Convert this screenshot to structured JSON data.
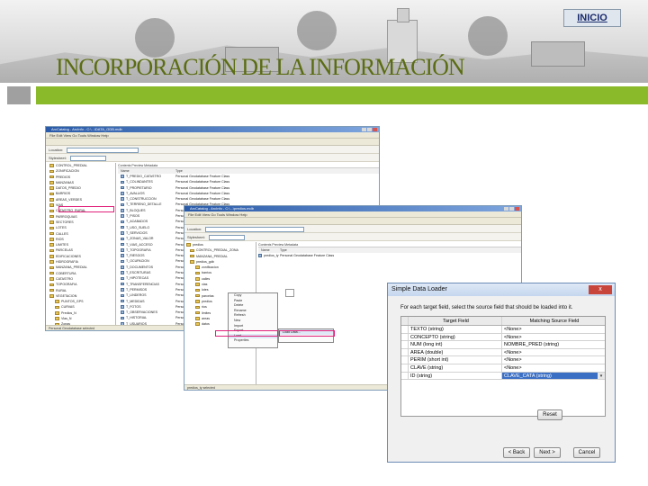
{
  "header": {
    "inicio_label": "INICIO",
    "title": "INCORPORACIÓN DE LA INFORMACIÓN"
  },
  "colors": {
    "title": "#5b6d13",
    "green_bar": "#8ab929",
    "highlight": "#e0207a",
    "selection": "#3b6fc4"
  },
  "window1": {
    "title": "ArcCatalog - ArcInfo - C:\\...\\DATA_GDB.mdb",
    "menu": "File  Edit  View  Go  Tools  Window  Help",
    "location_label": "Location:",
    "stylesheet_label": "Stylesheet:",
    "tabs": "Contents  Preview  Metadata",
    "col_name": "Name",
    "col_type": "Type",
    "tree": [
      "CONTROL_PREDIAL",
      "ZONIFICACION",
      "PREDIOS",
      "MANZANAS",
      "DATOS_PREDIO",
      "BARRIOS",
      "AREAS_VERDES",
      "VIAS",
      "CATASTRO_RURAL",
      "PARROQUIAS",
      "SECTORES",
      "LOTES",
      "CALLES",
      "RIOS",
      "LIMITES",
      "PARCELAS",
      "EDIFICACIONES",
      "HIDROGRAFIA",
      "MANZANA_PREDIAL",
      "COBERTURA",
      "CATASTRO",
      "TOPOGRAFIA",
      "RURAL",
      "VEGETACION",
      "PUNTOS_GPS",
      "CURVAS",
      "Predios_N",
      "Vias_N",
      "Zonas",
      "predios_gdb"
    ],
    "rows": [
      "T_PREDIO_CATASTRO",
      "T_COLINDANTES",
      "T_PROPIETARIO",
      "T_AVALUOS",
      "T_CONSTRUCCION",
      "T_TERRENO_DETALLE",
      "T_BLOQUES",
      "T_PISOS",
      "T_ACABADOS",
      "T_USO_SUELO",
      "T_SERVICIOS",
      "T_ZONAS_VALOR",
      "T_VIAS_ACCESO",
      "T_TOPOGRAFIA",
      "T_RIESGOS",
      "T_OCUPACION",
      "T_DOCUMENTOS",
      "T_ESCRITURAS",
      "T_HIPOTECAS",
      "T_TRANSFERENCIAS",
      "T_PERMISOS",
      "T_LINDEROS",
      "T_MEDIDAS",
      "T_FOTOS",
      "T_OBSERVACIONES",
      "T_HISTORIAL",
      "T_USUARIOS",
      "T_CLAVES",
      "T_MEJORAS",
      "T_ESTADO_LEGAL"
    ],
    "row_type": "Personal Geodatabase Feature Class",
    "status": "Personal Geodatabase selected"
  },
  "window2": {
    "title": "ArcCatalog - ArcInfo - C:\\...\\predios.mdb",
    "menu": "File  Edit  View  Go  Tools  Window  Help",
    "location_label": "Location:",
    "stylesheet_label": "Stylesheet:",
    "tabs": "Contents  Preview  Metadata",
    "col_name": "Name",
    "col_type": "Type",
    "row1_name": "predios_ty",
    "row1_type": "Personal Geodatabase Feature Class",
    "tree": [
      "predios",
      "CONTROL_PREDIAL_ZONA",
      "MANZANA_PREDIAL",
      "predios_gdb",
      "zonificacion",
      "barrios",
      "calles",
      "vias",
      "lotes",
      "parcelas",
      "predios",
      "rios",
      "limites",
      "areas",
      "datos"
    ],
    "menu_items": [
      "Copy",
      "Paste",
      "Delete",
      "Rename",
      "Refresh",
      "New",
      "Import",
      "Export",
      "Load",
      "Load Data...",
      "Properties"
    ],
    "status": "predios_ty selected"
  },
  "dialog": {
    "title": "Simple Data Loader",
    "close": "x",
    "instruction": "For each target field, select the source field that should be loaded into it.",
    "header_target": "Target Field",
    "header_source": "Matching Source Field",
    "rows": [
      {
        "target": "TEXTO (string)",
        "source": "<None>"
      },
      {
        "target": "CONCEPTO (string)",
        "source": "<None>"
      },
      {
        "target": "NUM (long int)",
        "source": "NOMBRE_PRED (string)"
      },
      {
        "target": "AREA (double)",
        "source": "<None>"
      },
      {
        "target": "PERIM (short int)",
        "source": "<None>"
      },
      {
        "target": "CLAVE (string)",
        "source": "<None>"
      },
      {
        "target": "ID (string)",
        "source": "CLAVE_CATA (string)"
      }
    ],
    "reset": "Reset",
    "back": "< Back",
    "next": "Next >",
    "cancel": "Cancel"
  }
}
